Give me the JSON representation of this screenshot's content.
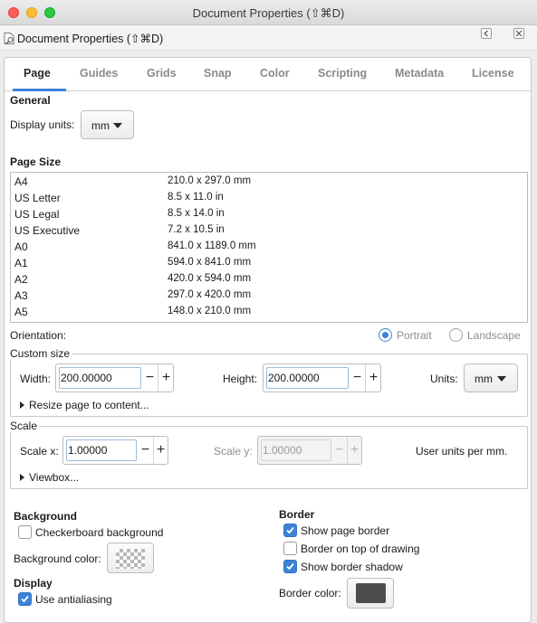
{
  "window": {
    "title": "Document Properties (⇧⌘D)"
  },
  "dock": {
    "title": "Document Properties (⇧⌘D)"
  },
  "tabs": [
    "Page",
    "Guides",
    "Grids",
    "Snap",
    "Color",
    "Scripting",
    "Metadata",
    "License"
  ],
  "general": {
    "heading": "General",
    "display_units_label": "Display units:",
    "display_units_value": "mm"
  },
  "page_size": {
    "heading": "Page Size",
    "rows": [
      {
        "name": "A4",
        "dims": "210.0 x 297.0 mm"
      },
      {
        "name": "US Letter",
        "dims": "8.5 x 11.0 in"
      },
      {
        "name": "US Legal",
        "dims": "8.5 x 14.0 in"
      },
      {
        "name": "US Executive",
        "dims": "7.2 x 10.5 in"
      },
      {
        "name": "A0",
        "dims": "841.0 x 1189.0 mm"
      },
      {
        "name": "A1",
        "dims": "594.0 x 841.0 mm"
      },
      {
        "name": "A2",
        "dims": "420.0 x 594.0 mm"
      },
      {
        "name": "A3",
        "dims": "297.0 x 420.0 mm"
      },
      {
        "name": "A5",
        "dims": "148.0 x 210.0 mm"
      }
    ]
  },
  "orientation": {
    "label": "Orientation:",
    "portrait": "Portrait",
    "landscape": "Landscape",
    "selected": "Portrait"
  },
  "custom_size": {
    "label": "Custom size",
    "width_label": "Width:",
    "width_value": "200.00000",
    "height_label": "Height:",
    "height_value": "200.00000",
    "units_label": "Units:",
    "units_value": "mm",
    "resize_label": "Resize page to content..."
  },
  "scale": {
    "label": "Scale",
    "scale_x_label": "Scale x:",
    "scale_x_value": "1.00000",
    "scale_y_label": "Scale y:",
    "scale_y_value": "1.00000",
    "user_units": "User units per mm.",
    "viewbox_label": "Viewbox..."
  },
  "background": {
    "heading": "Background",
    "checkerboard_label": "Checkerboard background",
    "checkerboard_checked": false,
    "color_label": "Background color:"
  },
  "display": {
    "heading": "Display",
    "antialiasing_label": "Use antialiasing",
    "antialiasing_checked": true
  },
  "border": {
    "heading": "Border",
    "show_border_label": "Show page border",
    "show_border_checked": true,
    "on_top_label": "Border on top of drawing",
    "on_top_checked": false,
    "shadow_label": "Show border shadow",
    "shadow_checked": true,
    "color_label": "Border color:",
    "color_value": "#4d4d4d"
  },
  "symbols": {
    "minus": "−",
    "plus": "+"
  },
  "colors": {
    "accent": "#3d82d8",
    "border_swatch": "#4d4d4d"
  }
}
